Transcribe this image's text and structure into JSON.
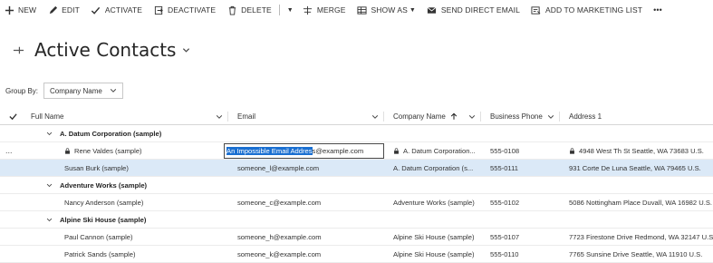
{
  "command_bar": {
    "items": [
      {
        "label": "NEW",
        "icon": "plus-icon"
      },
      {
        "label": "EDIT",
        "icon": "pencil-icon"
      },
      {
        "label": "ACTIVATE",
        "icon": "check-icon"
      },
      {
        "label": "DEACTIVATE",
        "icon": "deactivate-icon"
      },
      {
        "label": "DELETE",
        "icon": "trash-icon"
      },
      {
        "label": "MERGE",
        "icon": "merge-icon"
      },
      {
        "label": "SHOW AS",
        "icon": "show-as-icon"
      },
      {
        "label": "SEND DIRECT EMAIL",
        "icon": "envelope-icon"
      },
      {
        "label": "ADD TO MARKETING LIST",
        "icon": "marketing-list-icon"
      },
      {
        "label": "•••",
        "icon": "more-icon"
      }
    ]
  },
  "view": {
    "title": "Active Contacts"
  },
  "group_by": {
    "label": "Group By:",
    "selected": "Company Name"
  },
  "grid": {
    "columns": [
      {
        "label": "Full Name"
      },
      {
        "label": "Email"
      },
      {
        "label": "Company Name"
      },
      {
        "label": "Business Phone"
      },
      {
        "label": "Address 1"
      }
    ],
    "groups": [
      {
        "name": "A. Datum Corporation (sample)",
        "rows": [
          {
            "name": "Rene Valdes (sample)",
            "email_selected": "An Impossible Email Addres",
            "email_rest": "s@example.com",
            "company": "A. Datum Corporation...",
            "phone": "555-0108",
            "address": "4948 West Th St Seattle, WA 73683 U.S.",
            "locked": true,
            "editing": true,
            "more": "..."
          },
          {
            "name": "Susan Burk (sample)",
            "email": "someone_l@example.com",
            "company": "A. Datum Corporation (s...",
            "phone": "555-0111",
            "address": "931 Corte De Luna Seattle, WA 79465 U.S."
          }
        ]
      },
      {
        "name": "Adventure Works (sample)",
        "rows": [
          {
            "name": "Nancy Anderson (sample)",
            "email": "someone_c@example.com",
            "company": "Adventure Works (sample)",
            "phone": "555-0102",
            "address": "5086 Nottingham Place Duvall, WA 16982 U.S."
          }
        ]
      },
      {
        "name": "Alpine Ski House (sample)",
        "rows": [
          {
            "name": "Paul Cannon (sample)",
            "email": "someone_h@example.com",
            "company": "Alpine Ski House (sample)",
            "phone": "555-0107",
            "address": "7723 Firestone Drive Redmond, WA 32147 U.S."
          },
          {
            "name": "Patrick Sands (sample)",
            "email": "someone_k@example.com",
            "company": "Alpine Ski House (sample)",
            "phone": "555-0110",
            "address": "7765 Sunsine Drive Seattle, WA 11910 U.S."
          }
        ]
      }
    ]
  }
}
